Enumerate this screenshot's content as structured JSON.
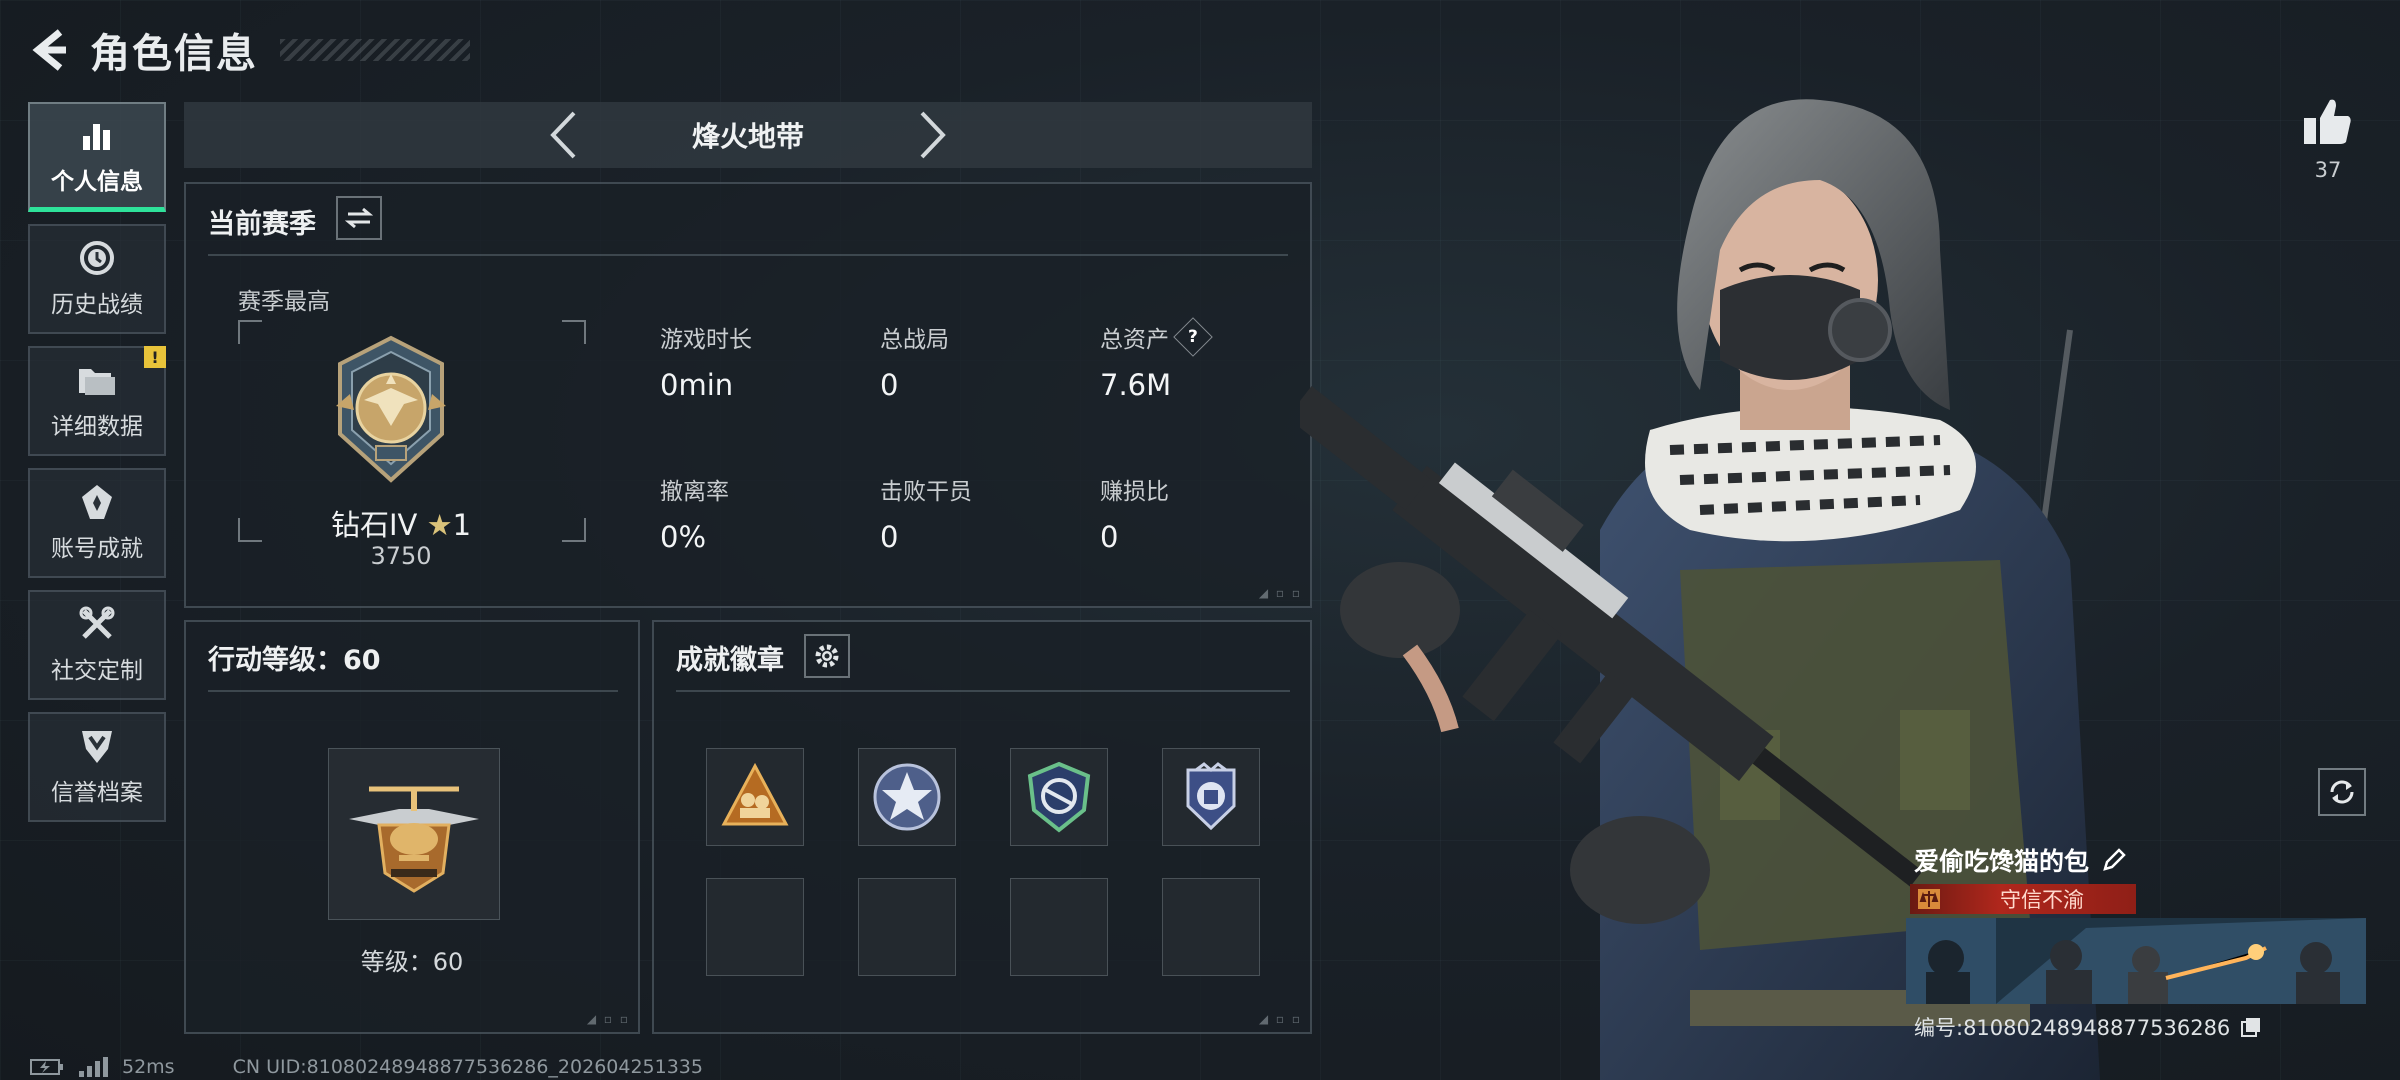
{
  "header": {
    "title": "角色信息"
  },
  "sidebar": {
    "items": [
      {
        "label": "个人信息",
        "icon": "bar-chart-icon",
        "active": true
      },
      {
        "label": "历史战绩",
        "icon": "history-icon"
      },
      {
        "label": "详细数据",
        "icon": "folder-icon",
        "badge": "!"
      },
      {
        "label": "账号成就",
        "icon": "achievement-icon"
      },
      {
        "label": "社交定制",
        "icon": "tools-icon"
      },
      {
        "label": "信誉档案",
        "icon": "credit-shield-icon"
      }
    ]
  },
  "mode": {
    "title": "烽火地带"
  },
  "season": {
    "heading": "当前赛季",
    "best_label": "赛季最高",
    "rank_name": "钻石IV",
    "rank_star_count": "1",
    "rank_score": "3750",
    "stats": [
      {
        "label": "游戏时长",
        "value": "0min"
      },
      {
        "label": "总战局",
        "value": "0"
      },
      {
        "label": "总资产",
        "value": "7.6M",
        "help": "?"
      },
      {
        "label": "撤离率",
        "value": "0%"
      },
      {
        "label": "击败干员",
        "value": "0"
      },
      {
        "label": "赚损比",
        "value": "0"
      }
    ]
  },
  "level": {
    "heading": "行动等级：60",
    "text": "等级：60"
  },
  "badges": {
    "heading": "成就徽章"
  },
  "profile": {
    "like_count": "37",
    "name": "爱偷吃馋猫的包",
    "credit_title": "守信不渝",
    "id_text": "编号:81080248948877536286"
  },
  "status": {
    "ping": "52ms",
    "uid": "CN UID:81080248948877536286_202604251335"
  },
  "colors": {
    "accent_green": "#2ee29a",
    "credit_red": "#b0271c",
    "warning_yellow": "#e8c33a"
  }
}
